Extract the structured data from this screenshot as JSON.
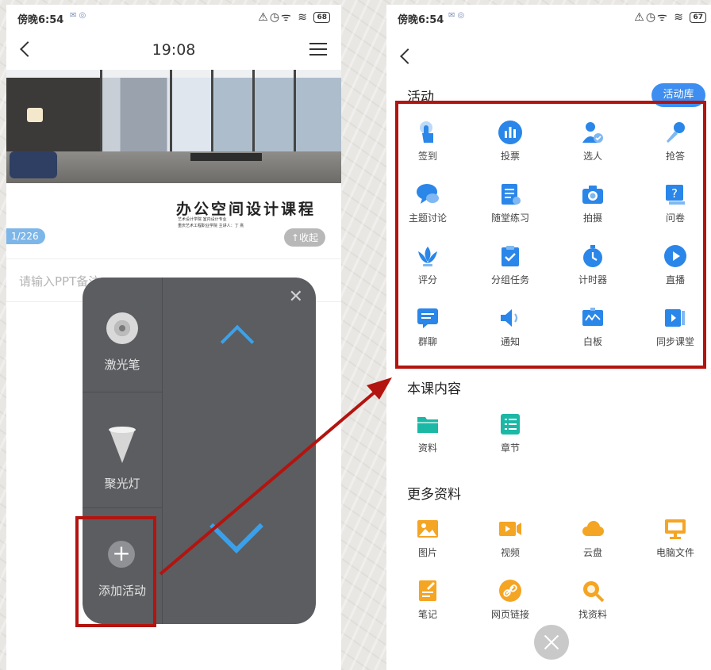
{
  "left": {
    "status": {
      "time": "傍晚6:54",
      "battery": "68"
    },
    "header": {
      "time": "19:08"
    },
    "slide": {
      "title": "办公空间设计课程",
      "subtitle1": "艺术设计学院  室内设计专业",
      "subtitle2": "重庆艺术工程职业学院  主讲人：丁 熹"
    },
    "page_badge": "1/226",
    "collapse_label": "↑收起",
    "note_placeholder": "请输入PPT备注",
    "tools": [
      {
        "label": "激光笔",
        "icon": "laser-pointer-icon"
      },
      {
        "label": "聚光灯",
        "icon": "spotlight-icon"
      },
      {
        "label": "添加活动",
        "icon": "plus-icon"
      }
    ]
  },
  "right": {
    "status": {
      "time": "傍晚6:54",
      "battery": "67"
    },
    "activities_title": "活动",
    "library_button": "活动库",
    "activities": [
      {
        "label": "签到",
        "icon": "tap-icon"
      },
      {
        "label": "投票",
        "icon": "vote-chart-icon"
      },
      {
        "label": "选人",
        "icon": "pick-person-icon"
      },
      {
        "label": "抢答",
        "icon": "microphone-icon"
      },
      {
        "label": "主题讨论",
        "icon": "chat-bubble-icon"
      },
      {
        "label": "随堂练习",
        "icon": "exercise-doc-icon"
      },
      {
        "label": "拍摄",
        "icon": "camera-icon"
      },
      {
        "label": "问卷",
        "icon": "questionnaire-icon"
      },
      {
        "label": "评分",
        "icon": "lotus-rating-icon"
      },
      {
        "label": "分组任务",
        "icon": "clipboard-check-icon"
      },
      {
        "label": "计时器",
        "icon": "stopwatch-icon"
      },
      {
        "label": "直播",
        "icon": "play-circle-icon"
      },
      {
        "label": "群聊",
        "icon": "group-chat-icon"
      },
      {
        "label": "通知",
        "icon": "speaker-icon"
      },
      {
        "label": "白板",
        "icon": "whiteboard-icon"
      },
      {
        "label": "同步课堂",
        "icon": "sync-class-icon"
      }
    ],
    "course_title": "本课内容",
    "course_items": [
      {
        "label": "资料",
        "icon": "folder-icon"
      },
      {
        "label": "章节",
        "icon": "chapter-list-icon"
      }
    ],
    "more_title": "更多资料",
    "more_items": [
      {
        "label": "图片",
        "icon": "image-icon"
      },
      {
        "label": "视频",
        "icon": "video-icon"
      },
      {
        "label": "云盘",
        "icon": "cloud-icon"
      },
      {
        "label": "电脑文件",
        "icon": "monitor-icon"
      },
      {
        "label": "笔记",
        "icon": "note-icon"
      },
      {
        "label": "网页链接",
        "icon": "link-icon"
      },
      {
        "label": "找资料",
        "icon": "search-icon"
      }
    ]
  },
  "colors": {
    "activity_blue": "#2a86e8",
    "course_teal": "#1bb8a6",
    "more_orange": "#f4a524",
    "highlight_red": "#b3140f"
  }
}
